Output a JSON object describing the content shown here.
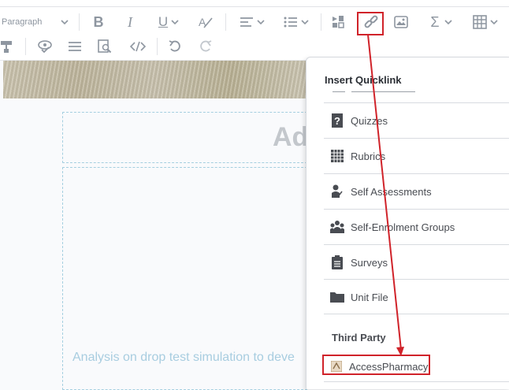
{
  "toolbar": {
    "format_label": "Paragraph",
    "icons": [
      "bold-icon",
      "italic-icon",
      "underline-icon",
      "strikeformat-icon",
      "align-icon",
      "list-icon",
      "media-icon",
      "link-icon",
      "image-icon",
      "sigma-icon",
      "table-icon",
      "format-painter-icon",
      "preview-icon",
      "hr-icon",
      "find-icon",
      "source-code-icon",
      "undo-icon",
      "redo-icon"
    ]
  },
  "editor": {
    "heading_fragment": "Ad",
    "body_fragment": "Analysis on drop test simulation to deve"
  },
  "quicklink": {
    "title": "Insert Quicklink",
    "items": [
      {
        "label": "Quizzes",
        "icon": "quiz-icon"
      },
      {
        "label": "Rubrics",
        "icon": "grid-icon"
      },
      {
        "label": "Self Assessments",
        "icon": "self-assessment-icon"
      },
      {
        "label": "Self-Enrolment Groups",
        "icon": "groups-icon"
      },
      {
        "label": "Surveys",
        "icon": "clipboard-icon"
      },
      {
        "label": "Unit File",
        "icon": "folder-icon"
      }
    ],
    "third_party_heading": "Third Party",
    "third_party_items": [
      {
        "label": "AccessPharmacy",
        "icon": "accesspharmacy-icon"
      }
    ]
  },
  "colors": {
    "highlight": "#d0232a",
    "toolbar_icon": "#8e96a0",
    "link_text": "#a8cde0"
  }
}
